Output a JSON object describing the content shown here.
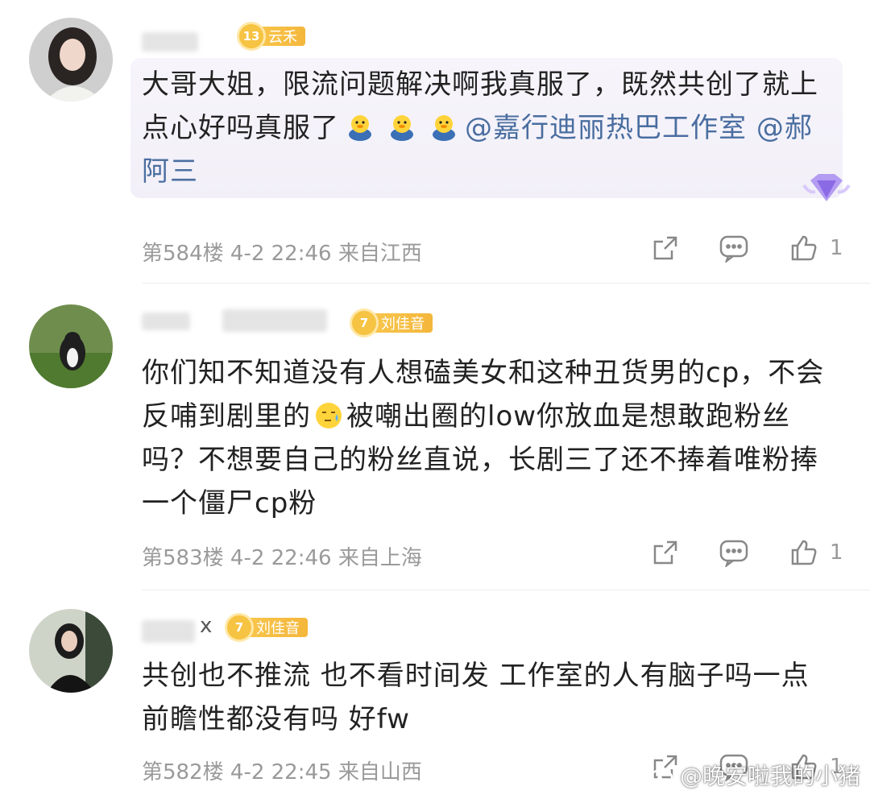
{
  "comments": [
    {
      "username_suffix": "",
      "badge": {
        "level": "13",
        "name": "云禾"
      },
      "text_main": "大哥大姐，限流问题解决啊我真服了，既然共创了就上点心好吗真服了",
      "emoji": [
        "duck-emoji",
        "duck-emoji",
        "duck-emoji"
      ],
      "mention1": "@嘉行迪丽热巴工作室",
      "mention2": "@郝阿三",
      "floor": "第584楼",
      "time": "4-2 22:46",
      "location": "来自江西",
      "likes": "1"
    },
    {
      "username_suffix": "",
      "badge": {
        "level": "7",
        "name": "刘佳音"
      },
      "text_a": "你们知不知道没有人想磕美女和这种丑货男的cp，不会反哺到剧里的",
      "emoji": [
        "sweat-face-emoji"
      ],
      "text_b": "被嘲出圈的low你放血是想敢跑粉丝吗？不想要自己的粉丝直说，长剧三了还不捧着唯粉捧一个僵尸cp粉",
      "floor": "第583楼",
      "time": "4-2 22:46",
      "location": "来自上海",
      "likes": "1"
    },
    {
      "username_suffix": "x",
      "badge": {
        "level": "7",
        "name": "刘佳音"
      },
      "text": "共创也不推流 也不看时间发  工作室的人有脑子吗一点前瞻性都没有吗 好fw",
      "floor": "第582楼",
      "time": "4-2 22:45",
      "location": "来自山西",
      "likes": "1"
    }
  ],
  "watermark": "@晚安啦我的小猪",
  "colors": {
    "mention": "#4a6ea0",
    "badge": "#f4b73c",
    "meta": "#9a9a9a"
  }
}
